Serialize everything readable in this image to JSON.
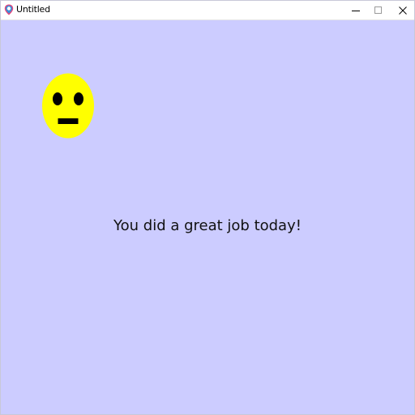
{
  "window": {
    "title": "Untitled",
    "controls": {
      "minimize_icon": "minimize-icon",
      "maximize_icon": "maximize-icon",
      "close_icon": "close-icon"
    },
    "app_icon": "app-icon"
  },
  "canvas": {
    "background": "#ccccff",
    "message": "You did a great job today!",
    "face": {
      "icon": "neutral-face-icon",
      "color": "#ffff00",
      "feature_color": "#000000"
    }
  }
}
